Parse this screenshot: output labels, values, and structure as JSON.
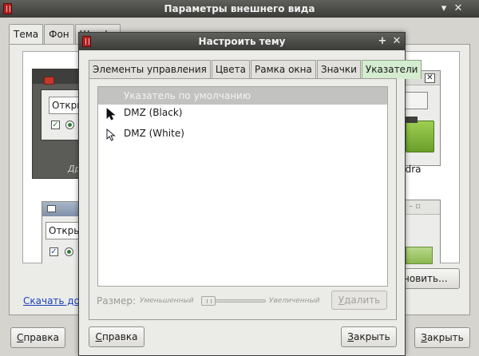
{
  "main_window": {
    "title": "Параметры внешнего вида",
    "controls": [
      "▾",
      "✕"
    ],
    "tabs": [
      {
        "label": "Тема",
        "active": true
      },
      {
        "label": "Фон",
        "active": false
      },
      {
        "label": "Шрифт",
        "active": false
      }
    ],
    "previews": {
      "p1_combo": "Откры",
      "p1_label": "Др",
      "p2_label": "ndra",
      "p3_combo": "Откры",
      "p4_title": "– ▫"
    },
    "install_button": "новить...",
    "download_link": "Скачать дол",
    "help_button": {
      "accel": "С",
      "rest": "правка"
    },
    "close_button": {
      "accel": "З",
      "rest": "акрыть"
    }
  },
  "dialog": {
    "title": "Настроить тему",
    "controls": [
      "+",
      "✕"
    ],
    "tabs": [
      {
        "label": "Элементы управления",
        "active": false
      },
      {
        "label": "Цвета",
        "active": false
      },
      {
        "label": "Рамка окна",
        "active": false
      },
      {
        "label": "Значки",
        "active": false
      },
      {
        "label": "Указатели",
        "active": true
      }
    ],
    "cursor_list": [
      {
        "label": "Указатель по умолчанию",
        "selected": true,
        "cursor": "none"
      },
      {
        "label": "DMZ (Black)",
        "selected": false,
        "cursor": "black-arrow"
      },
      {
        "label": "DMZ (White)",
        "selected": false,
        "cursor": "white-arrow"
      }
    ],
    "size": {
      "label": "Размер:",
      "min_label": "Уменьшенный",
      "max_label": "Увеличенный",
      "value": 0
    },
    "delete_button": {
      "accel": "У",
      "rest": "далить"
    },
    "help_button": {
      "accel": "С",
      "rest": "правка"
    },
    "close_button": {
      "accel": "З",
      "rest": "акрыть"
    }
  },
  "colors": {
    "active_tab": "#d4ecd0",
    "selected_row": "#c2c2c0",
    "link": "#1a3fbf",
    "app_icon": "#b32020"
  },
  "icons": {
    "app": "app-icon",
    "minimize": "chevron-down-icon",
    "close": "close-icon",
    "maximize": "plus-icon",
    "cursor_black": "black-cursor-icon",
    "cursor_white": "white-cursor-icon"
  }
}
